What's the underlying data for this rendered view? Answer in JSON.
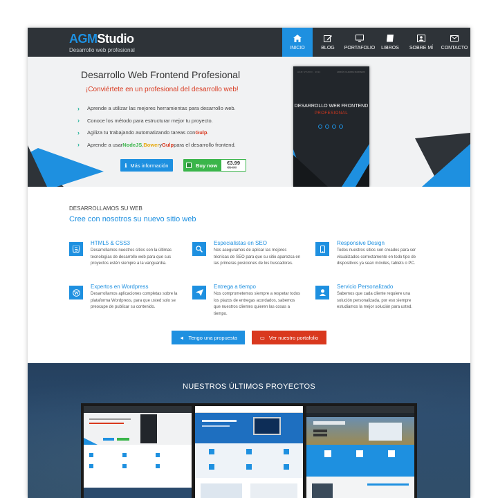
{
  "brand": {
    "name_part1": "AGM",
    "name_part2": "Studio",
    "tagline": "Desarrollo web profesional"
  },
  "nav": [
    {
      "label": "INICIO",
      "icon": "home-icon",
      "active": true
    },
    {
      "label": "BLOG",
      "icon": "edit-icon",
      "active": false
    },
    {
      "label": "PORTAFOLIO",
      "icon": "monitor-icon",
      "active": false
    },
    {
      "label": "LIBROS",
      "icon": "book-icon",
      "active": false
    },
    {
      "label": "SOBRE MÍ",
      "icon": "user-icon",
      "active": false
    },
    {
      "label": "CONTACTO",
      "icon": "envelope-icon",
      "active": false
    }
  ],
  "hero": {
    "title": "Desarrollo Web Frontend Profesional",
    "subtitle": "¡Conviértete en un profesional del desarrollo web!",
    "bullets": {
      "b1": "Aprende a utilizar las mejores herramientas para desarrollo web.",
      "b2": "Conoce los método para estructurar mejor tu proyecto.",
      "b3_pre": "Agiliza tu trabajando automatizando tareas con ",
      "b3_kw": "Gulp",
      "b3_post": ".",
      "b4_pre": "Aprende a usar ",
      "b4_kw1": "NodeJS",
      "b4_sep1": ", ",
      "b4_kw2": "Bower",
      "b4_sep2": " y ",
      "b4_kw3": "Gulp",
      "b4_post": " para el desarrollo frontend."
    },
    "info_button": "Más información",
    "buy_label": "Buy now",
    "price_now": "€3.99",
    "price_old": "€5.00",
    "book": {
      "top_left": "AGM STUDIO · 2014",
      "top_right": "ADRIÁN GUERRA MARRERO",
      "title": "DESARROLLO WEB FRONTEND",
      "subtitle": "PROFESIONAL"
    }
  },
  "services": {
    "eyebrow": "DESARROLLAMOS SU WEB",
    "title": "Cree con nosotros su nuevo sitio web",
    "items": [
      {
        "name": "HTML5 & CSS3",
        "icon": "html5-icon",
        "desc": "Desarrollamos nuestros sitios con la últimas tecnologías de desarrollo web para que sus proyectos estén siempre a la vanguardia."
      },
      {
        "name": "Especialistas en SEO",
        "icon": "search-icon",
        "desc": "Nos aseguramos de aplicar las mejores técnicas de SEO para que su sitio aparezca en las primeras posiciones de los buscadores."
      },
      {
        "name": "Responsive Design",
        "icon": "mobile-icon",
        "desc": "Todos nuestros sitios son creados para ser visualizados correctamente en todo tipo de dispositivos ya sean móviles, tablets o PC."
      },
      {
        "name": "Expertos en Wordpress",
        "icon": "wordpress-icon",
        "desc": "Desarrollamos aplicaciones completas sobre la plataforma Wordpress, para que usted solo se preocupe de publicar su contenido."
      },
      {
        "name": "Entrega a tiempo",
        "icon": "paper-plane-icon",
        "desc": "Nos comprometemos siempre a respetar todos los plazos de entregas acordados, sabemos que nuestros clientes quieren las cosas a tiempo."
      },
      {
        "name": "Servicio Personalizado",
        "icon": "user-icon",
        "desc": "Sabemos que cada cliente requiere una solución personalizada, por eso siempre estudiamos la mejor solución para usted."
      }
    ],
    "propuesta_button": "Tengo una propuesta",
    "portfolio_button": "Ver nuestro portafolio"
  },
  "projects": {
    "title": "NUESTROS ÚLTIMOS PROYECTOS"
  },
  "colors": {
    "accent": "#1e90e0",
    "dark": "#2e3338",
    "red": "#d9381e",
    "green": "#3ab54a"
  }
}
